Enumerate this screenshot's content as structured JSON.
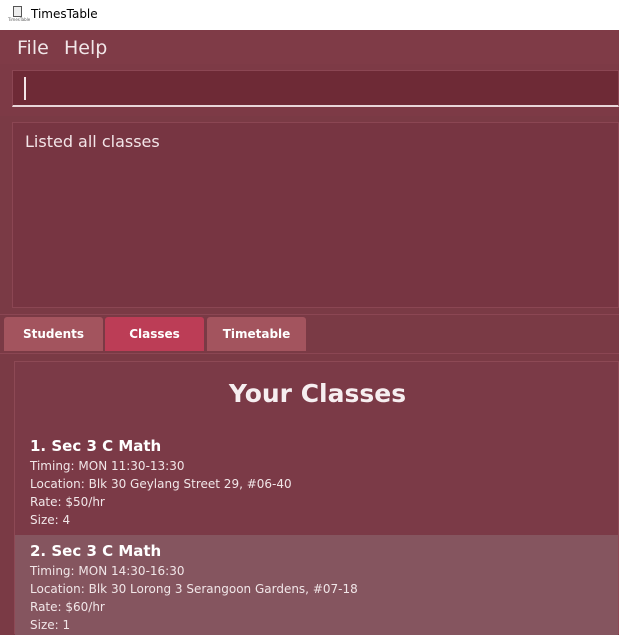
{
  "window": {
    "title": "TimesTable",
    "icon_caption": "TimesTable",
    "icon": "app-document-icon"
  },
  "menu": {
    "file": "File",
    "help": "Help"
  },
  "command": {
    "value": "",
    "placeholder": ""
  },
  "result": {
    "text": "Listed all classes"
  },
  "tabs": [
    {
      "label": "Students",
      "selected": false
    },
    {
      "label": "Classes",
      "selected": true
    },
    {
      "label": "Timetable",
      "selected": false
    }
  ],
  "colors": {
    "tab_default": "#a3545e",
    "tab_selected": "#bc3d56"
  },
  "panel": {
    "title": "Your Classes"
  },
  "classes": [
    {
      "name": "1.  Sec 3 C Math",
      "timing": "Timing: MON 11:30-13:30",
      "location": "Location: Blk 30 Geylang Street 29, #06-40",
      "rate": "Rate: $50/hr",
      "size": "Size: 4",
      "selected": false
    },
    {
      "name": "2.  Sec 3 C Math",
      "timing": "Timing: MON 14:30-16:30",
      "location": "Location: Blk 30 Lorong 3 Serangoon Gardens, #07-18",
      "rate": "Rate: $60/hr",
      "size": "Size: 1",
      "selected": true
    }
  ]
}
